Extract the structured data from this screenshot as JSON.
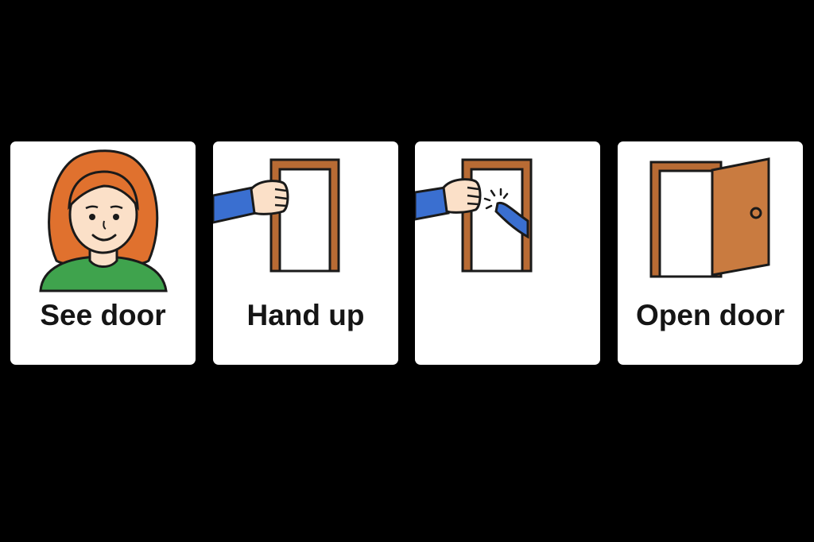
{
  "cards": [
    {
      "label": "See door",
      "picture": "woman-face-icon"
    },
    {
      "label": "Hand up",
      "picture": "hand-on-door-frame-icon"
    },
    {
      "label": "",
      "picture": "hand-knocking-door-icon"
    },
    {
      "label": "Open door",
      "picture": "open-door-icon"
    }
  ],
  "colors": {
    "background": "#000000",
    "card": "#ffffff",
    "hair": "#e0712e",
    "skin": "#fbe0c8",
    "shirt": "#3fa34d",
    "sleeve": "#3a6fd0",
    "door_frame": "#b86b34",
    "door_panel": "#c97b40",
    "outline": "#1a1a1a"
  }
}
